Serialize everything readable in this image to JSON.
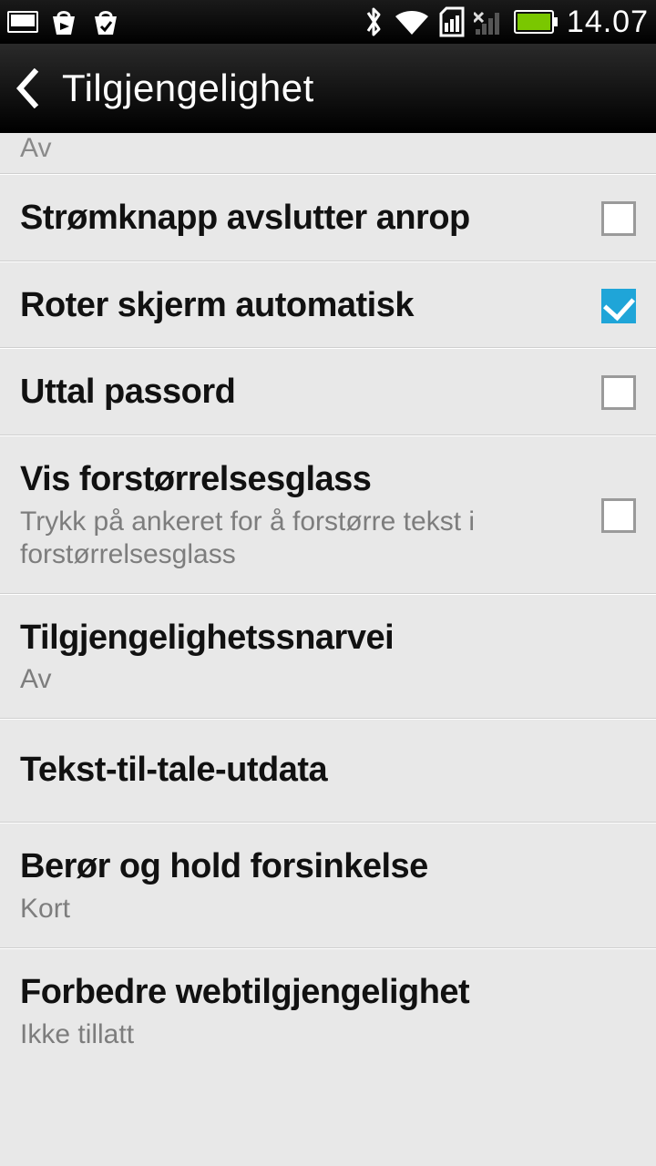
{
  "status": {
    "time": "14.07"
  },
  "nav": {
    "title": "Tilgjengelighet"
  },
  "rows": {
    "partial_sub": "Av",
    "power_button": {
      "label": "Strømknapp avslutter anrop"
    },
    "auto_rotate": {
      "label": "Roter skjerm automatisk"
    },
    "speak_passwords": {
      "label": "Uttal passord"
    },
    "magnifier": {
      "label": "Vis forstørrelsesglass",
      "sub": "Trykk på ankeret for å forstørre tekst i forstørrelsesglass"
    },
    "shortcut": {
      "label": "Tilgjengelighetssnarvei",
      "sub": "Av"
    },
    "tts": {
      "label": "Tekst-til-tale-utdata"
    },
    "touch_delay": {
      "label": "Berør og hold forsinkelse",
      "sub": "Kort"
    },
    "web_access": {
      "label": "Forbedre webtilgjengelighet",
      "sub": "Ikke tillatt"
    }
  }
}
